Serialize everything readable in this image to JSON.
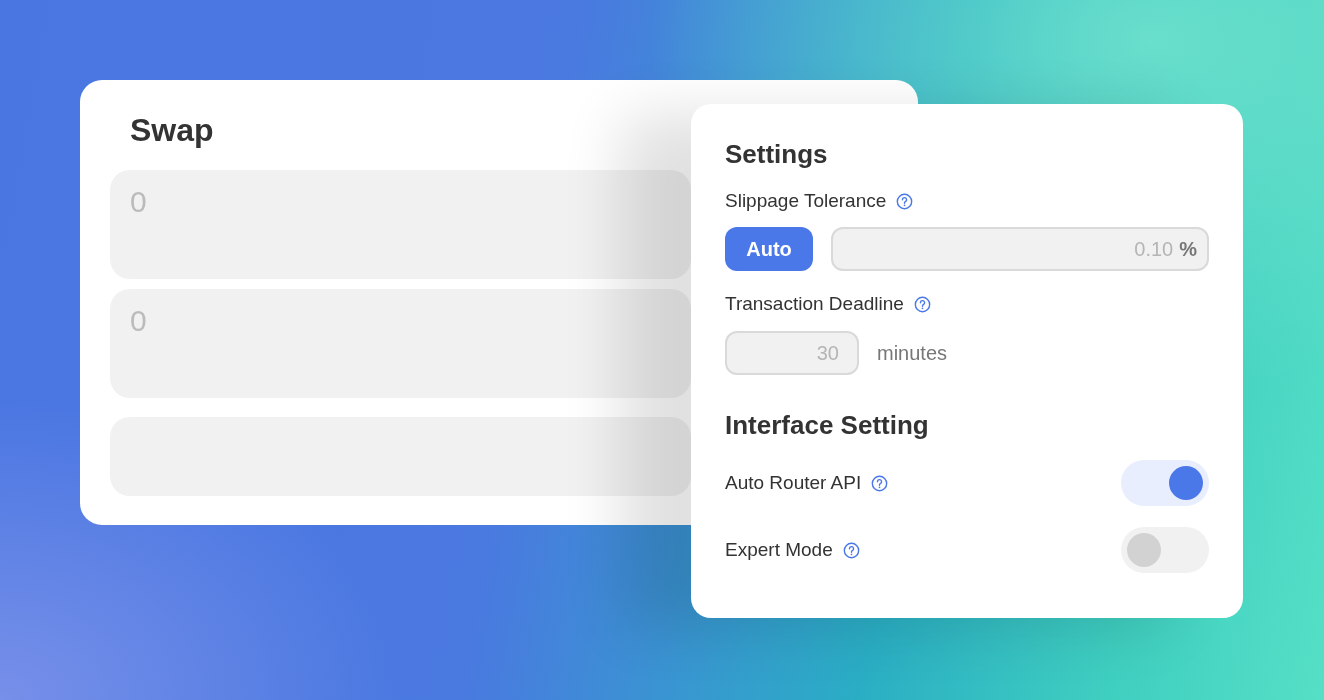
{
  "swap": {
    "title": "Swap",
    "inputs": [
      {
        "placeholder": "0"
      },
      {
        "placeholder": "0"
      }
    ]
  },
  "settings": {
    "title": "Settings",
    "slippage": {
      "label": "Slippage Tolerance",
      "auto_button": {
        "label": "Auto",
        "selected": true
      },
      "placeholder": "0.10",
      "unit": "%"
    },
    "deadline": {
      "label": "Transaction Deadline",
      "placeholder": "30",
      "unit": "minutes"
    },
    "interface": {
      "title": "Interface Setting",
      "toggles": [
        {
          "label": "Auto Router API",
          "on": true
        },
        {
          "label": "Expert Mode",
          "on": false
        }
      ]
    }
  }
}
